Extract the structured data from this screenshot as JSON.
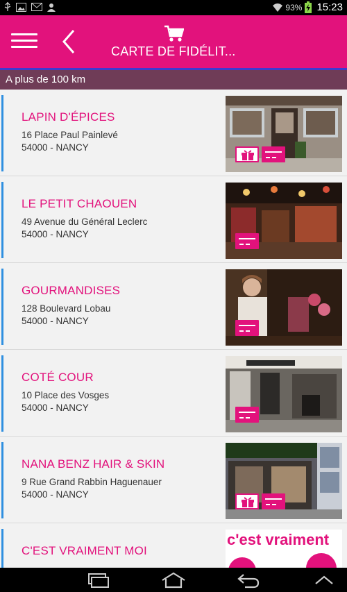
{
  "statusbar": {
    "battery": "93%",
    "time": "15:23"
  },
  "appbar": {
    "title": "CARTE DE FIDÉLIT..."
  },
  "section": {
    "header": "A plus de 100 km"
  },
  "shops": [
    {
      "name": "LAPIN D'ÉPICES",
      "address": "16 Place Paul Painlevé",
      "city": "54000 - NANCY",
      "gift": true
    },
    {
      "name": "LE PETIT CHAOUEN",
      "address": "49 Avenue du Général Leclerc",
      "city": "54000 - NANCY",
      "gift": false
    },
    {
      "name": "GOURMANDISES",
      "address": "128 Boulevard Lobau",
      "city": "54000 - NANCY",
      "gift": false
    },
    {
      "name": "COTÉ COUR",
      "address": "10 Place des Vosges",
      "city": "54000 - NANCY",
      "gift": false
    },
    {
      "name": "NANA BENZ HAIR & SKIN",
      "address": "9 Rue Grand Rabbin Haguenauer",
      "city": "54000 - NANCY",
      "gift": true
    },
    {
      "name": "C'EST VRAIMENT MOI",
      "address": "",
      "city": "",
      "gift": false,
      "thumb_text": "c'est vraiment"
    }
  ],
  "colors": {
    "brand": "#e2127c",
    "section_bg": "#6f3c57",
    "accent_line": "#2f8fe0"
  }
}
